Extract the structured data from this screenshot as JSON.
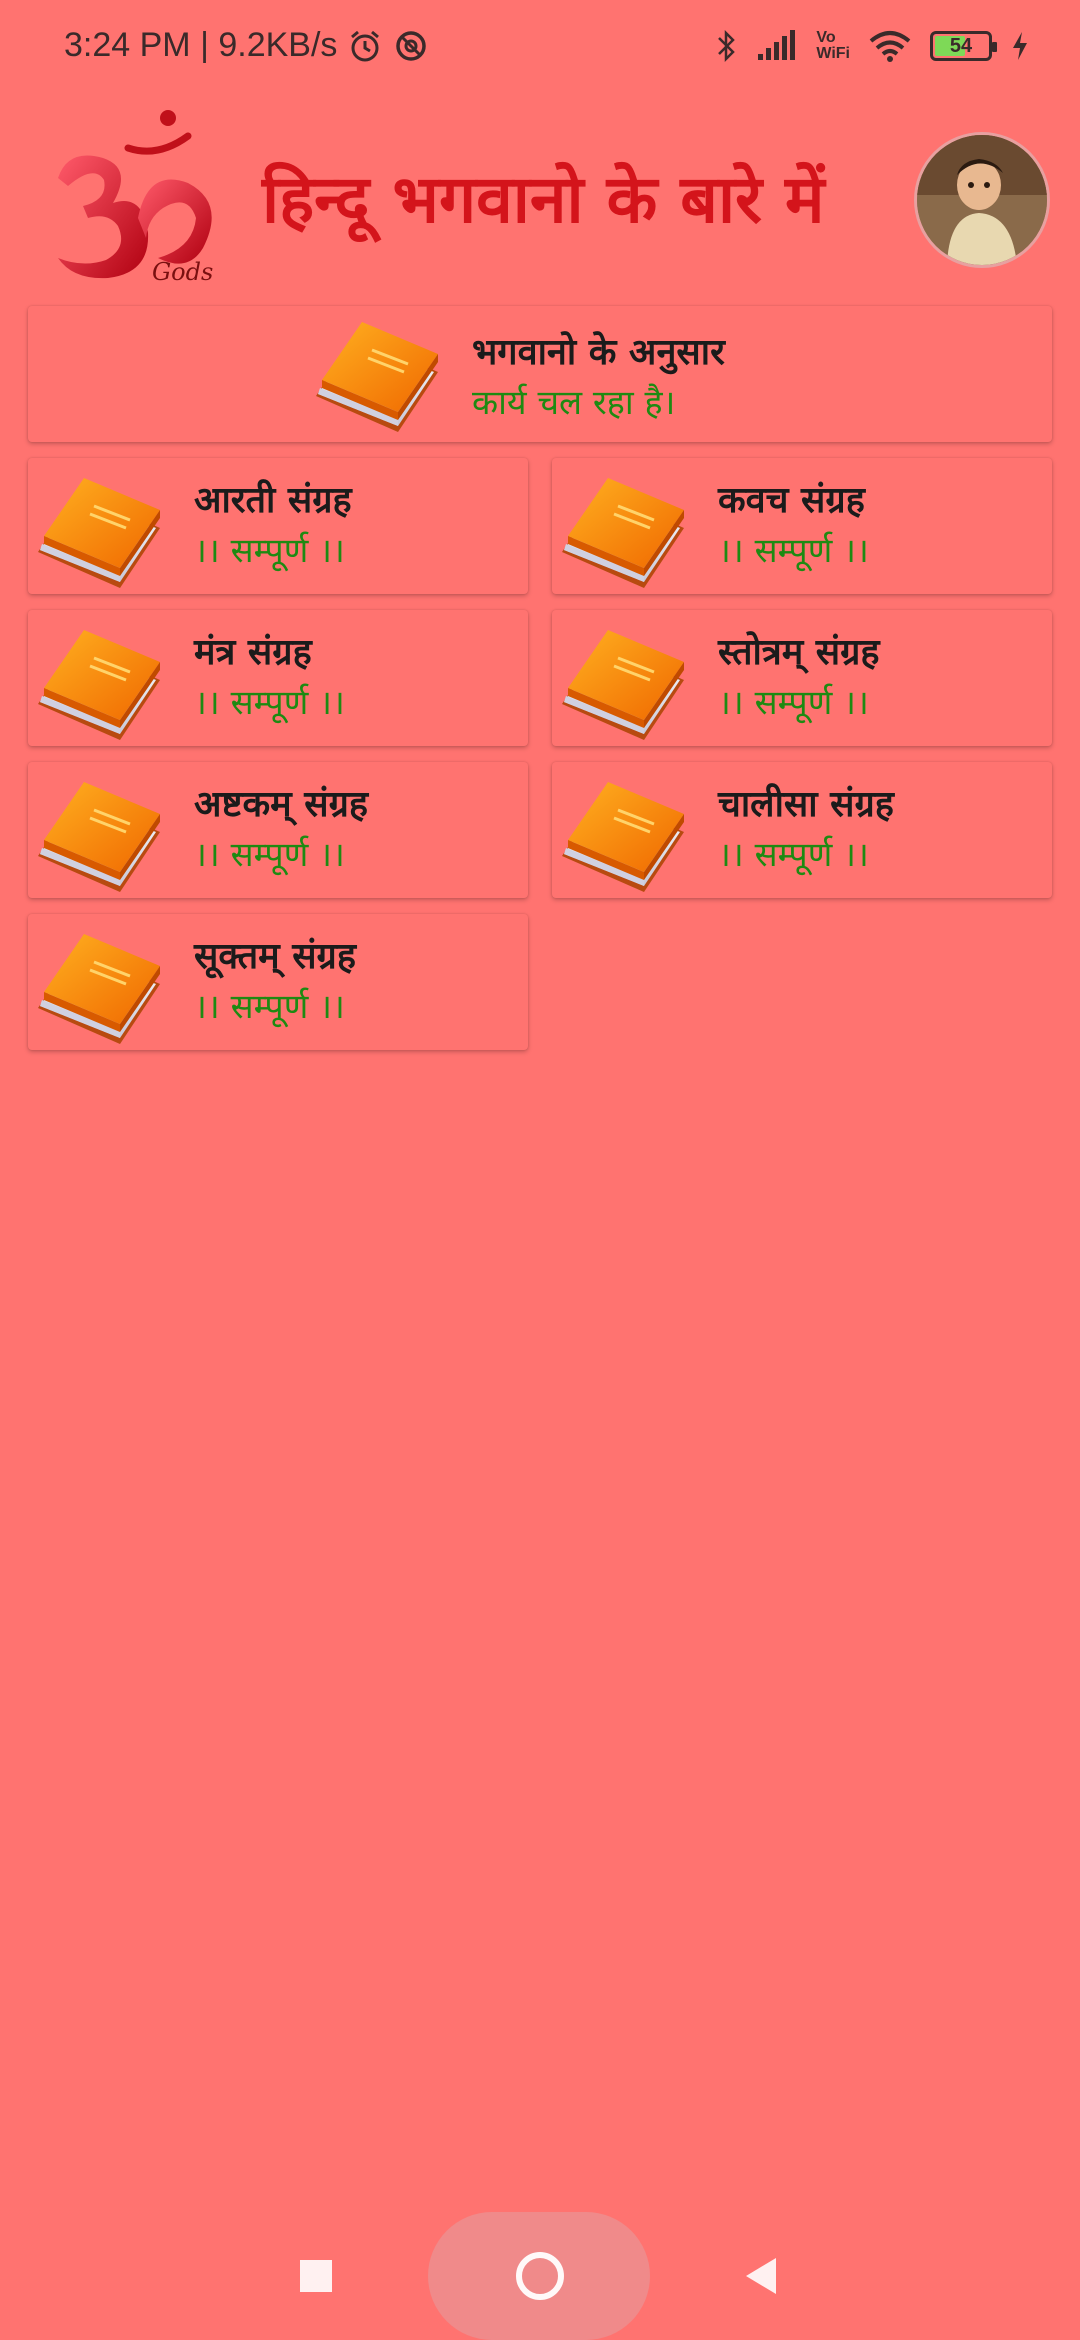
{
  "status_bar": {
    "time_speed": "3:24 PM | 9.2KB/s",
    "battery_level": "54",
    "vowifi_top": "Vo",
    "vowifi_bottom": "WiFi"
  },
  "header": {
    "title": "हिन्दू भगवानो के बारे में",
    "logo_caption": "Gods"
  },
  "featured": {
    "title": "भगवानो के अनुसार",
    "status": "कार्य चल रहा है।"
  },
  "items": [
    {
      "title": "आरती संग्रह",
      "status": "।। सम्पूर्ण ।।"
    },
    {
      "title": "कवच संग्रह",
      "status": "।। सम्पूर्ण ।।"
    },
    {
      "title": "मंत्र संग्रह",
      "status": "।। सम्पूर्ण ।।"
    },
    {
      "title": "स्तोत्रम् संग्रह",
      "status": "।। सम्पूर्ण ।।"
    },
    {
      "title": "अष्टकम् संग्रह",
      "status": "।। सम्पूर्ण ।।"
    },
    {
      "title": "चालीसा संग्रह",
      "status": "।। सम्पूर्ण ।।"
    },
    {
      "title": "सूक्तम् संग्रह",
      "status": "।। सम्पूर्ण ।।"
    }
  ],
  "colors": {
    "background": "#ff7370",
    "title_red": "#d4141b",
    "status_green": "#1e8a12"
  }
}
